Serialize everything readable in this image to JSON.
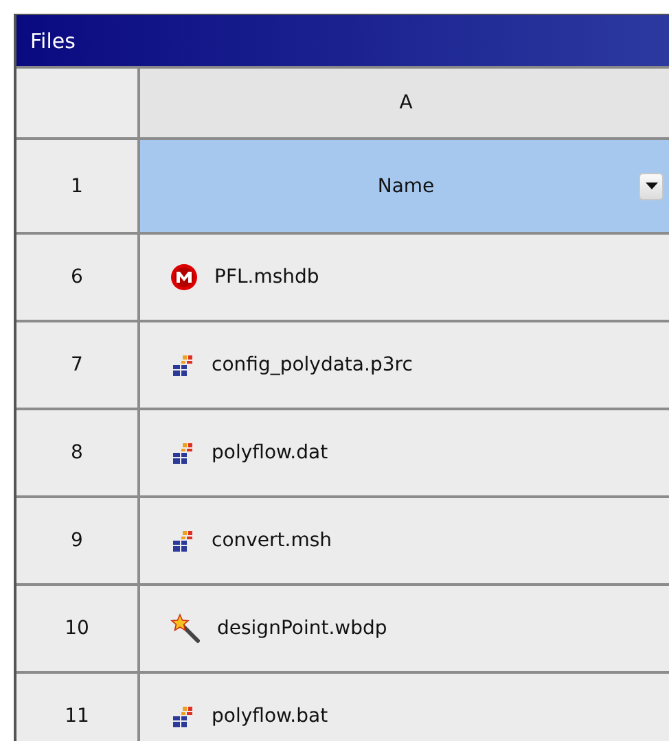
{
  "panel": {
    "title": "Files"
  },
  "table": {
    "columns": [
      {
        "label": "A"
      }
    ],
    "header_row": {
      "number": "1",
      "label": "Name"
    },
    "rows": [
      {
        "number": "6",
        "kind": "mesh",
        "name": "PFL.mshdb"
      },
      {
        "number": "7",
        "kind": "polyflow",
        "name": "config_polydata.p3rc"
      },
      {
        "number": "8",
        "kind": "polyflow",
        "name": "polyflow.dat"
      },
      {
        "number": "9",
        "kind": "polyflow",
        "name": "convert.msh"
      },
      {
        "number": "10",
        "kind": "wizard",
        "name": "designPoint.wbdp"
      },
      {
        "number": "11",
        "kind": "polyflow",
        "name": "polyflow.bat"
      }
    ]
  }
}
